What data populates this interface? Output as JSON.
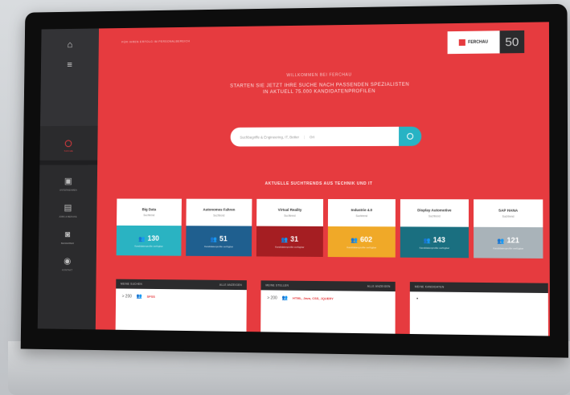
{
  "sidebar": {
    "icons": [
      "menu-icon",
      "hamburger-icon"
    ],
    "search_label": "SUCHE",
    "items": [
      {
        "icon": "building-icon",
        "label": "UNTERNEHMEN"
      },
      {
        "icon": "document-icon",
        "label": "JOBS & BERUFE"
      },
      {
        "icon": "user-icon",
        "label": "BEWERBER"
      },
      {
        "icon": "person-icon",
        "label": "KONTAKT"
      }
    ]
  },
  "header": {
    "topline": "FÜR IHREN ERFOLG IM PERSONALBEREICH",
    "logo_text": "FERCHAU",
    "logo_badge": "50"
  },
  "hero": {
    "small": "WILLKOMMEN BEI FERCHAU",
    "big_line1": "STARTEN SIE JETZT IHRE SUCHE NACH PASSENDEN SPEZIALISTEN",
    "big_line2": "IN AKTUELL 75.000 KANDIDATENPROFILEN"
  },
  "search": {
    "placeholder": "Suchbegriffe & Engineering, IT, Better",
    "location": "Ort"
  },
  "trends": {
    "title": "AKTUELLE SUCHTRENDS AUS TECHNIK UND IT",
    "cards": [
      {
        "name": "Big Data",
        "sub": "Suchtrend",
        "count": "130",
        "caption": "Kandidatenprofile verfügbar",
        "color": "#2ab3c2"
      },
      {
        "name": "Autonomes Fahren",
        "sub": "Suchtrend",
        "count": "51",
        "caption": "Kandidatenprofile verfügbar",
        "color": "#1f5f8f"
      },
      {
        "name": "Virtual Reality",
        "sub": "Suchtrend",
        "count": "31",
        "caption": "Kandidatenprofile verfügbar",
        "color": "#a51e22"
      },
      {
        "name": "Industrie 4.0",
        "sub": "Suchtrend",
        "count": "602",
        "caption": "Kandidatenprofile verfügbar",
        "color": "#f0a928"
      },
      {
        "name": "Display Automotive",
        "sub": "Suchtrend",
        "count": "143",
        "caption": "Kandidatenprofile verfügbar",
        "color": "#1a6f80"
      },
      {
        "name": "SAP HANA",
        "sub": "Suchtrend",
        "count": "121",
        "caption": "Kandidatenprofile verfügbar",
        "color": "#a9b3b9"
      }
    ]
  },
  "panels": [
    {
      "title": "MEINE SUCHEN",
      "action": "ALLE ANZEIGEN",
      "rows": [
        {
          "num": "> 200",
          "text": "SPSS",
          "sub": ""
        },
        {
          "num": "",
          "text": "",
          "sub": ""
        }
      ]
    },
    {
      "title": "MEINE STELLEN",
      "action": "ALLE ANZEIGEN",
      "rows": [
        {
          "num": "> 200",
          "text": "HTML, Java, CSS, JQUERY",
          "sub": ""
        },
        {
          "num": "",
          "text": "",
          "sub": ""
        }
      ]
    },
    {
      "title": "MEINE KANDIDATEN",
      "action": "",
      "rows": [
        {
          "num": "",
          "text": "",
          "sub": ""
        },
        {
          "num": "",
          "text": "",
          "sub": ""
        }
      ]
    }
  ]
}
